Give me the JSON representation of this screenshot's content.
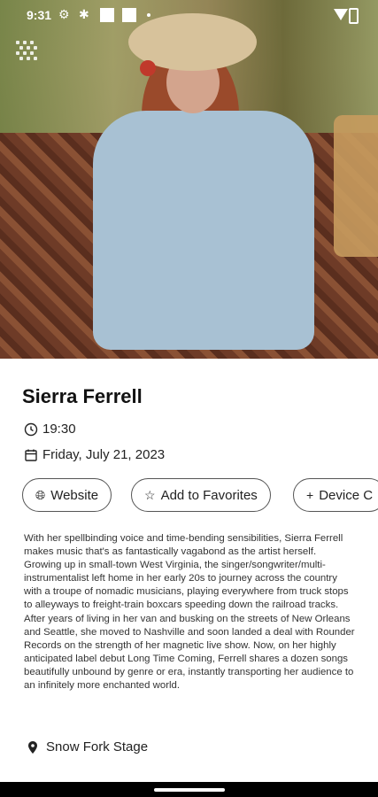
{
  "status_bar": {
    "time": "9:31",
    "icons": [
      "gear-icon",
      "settings-alt-icon",
      "square-icon",
      "square-icon",
      "dot-icon",
      "wifi-icon",
      "battery-icon"
    ]
  },
  "event": {
    "artist": "Sierra Ferrell",
    "time": "19:30",
    "date": "Friday, July 21, 2023",
    "stage": "Snow Fork Stage",
    "description": "With her spellbinding voice and time-bending sensibilities, Sierra Ferrell makes music that's as fantastically vagabond as the artist herself. Growing up in small-town West Virginia, the singer/songwriter/multi-instrumentalist left home in her early 20s to journey across the country with a troupe of nomadic musicians, playing everywhere from truck stops to alleyways to freight-train boxcars speeding down the railroad tracks. After years of living in her van and busking on the streets of New Orleans and Seattle, she moved to Nashville and soon landed a deal with Rounder Records on the strength of her magnetic live show. Now, on her highly anticipated label debut Long Time Coming, Ferrell shares a dozen songs beautifully unbound by genre or era, instantly transporting her audience to an infinitely more enchanted world."
  },
  "actions": {
    "website": "Website",
    "favorites": "Add to Favorites",
    "calendar": "Device C"
  },
  "colors": {
    "text": "#222222",
    "outline": "#555555"
  }
}
